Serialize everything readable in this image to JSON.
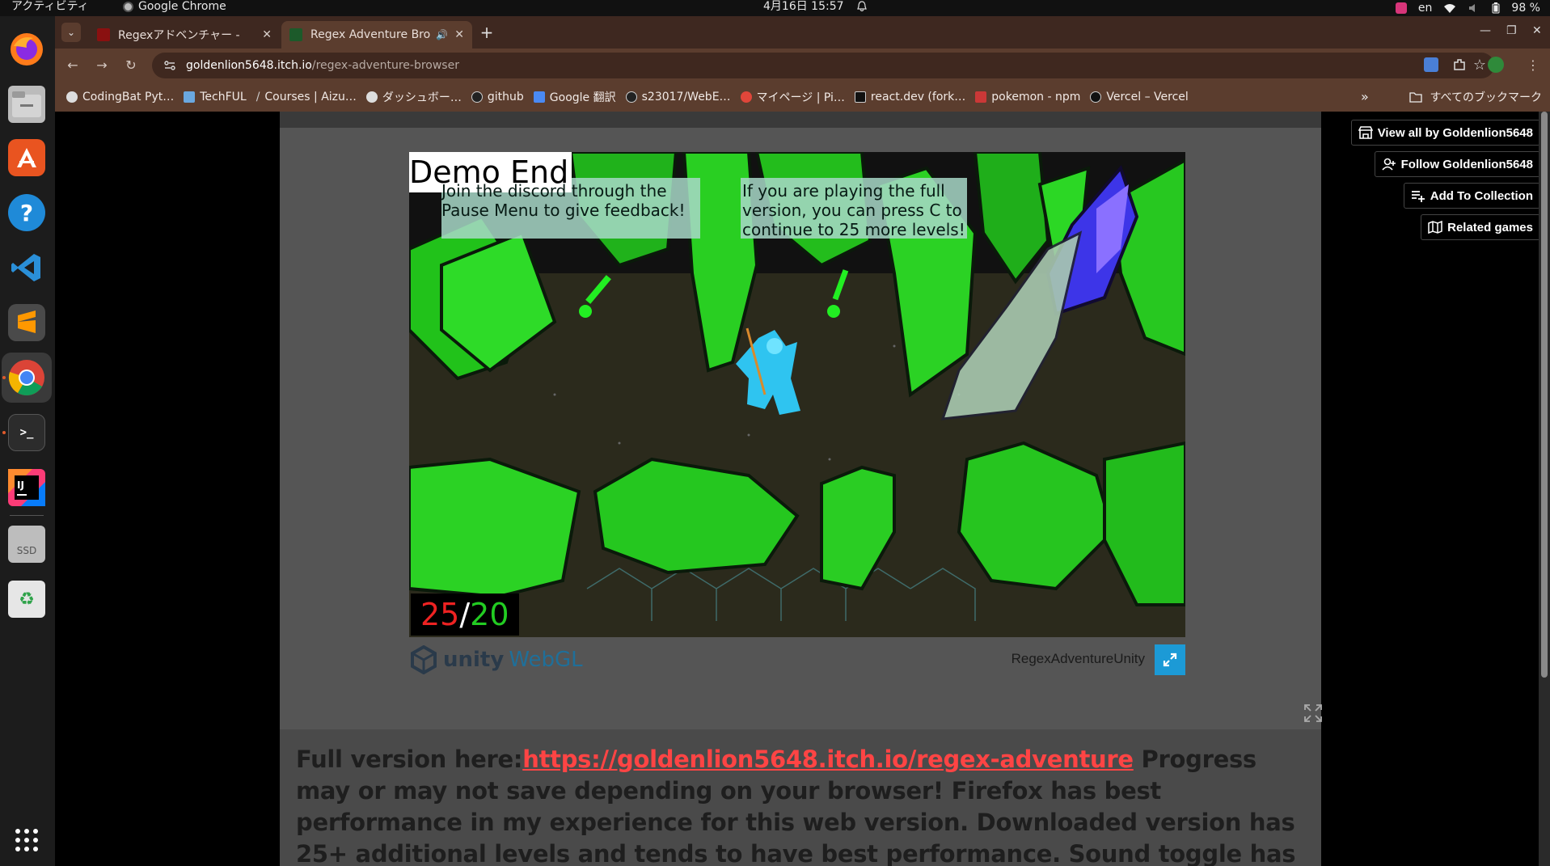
{
  "system_bar": {
    "activities": "アクティビティ",
    "app_name": "Google Chrome",
    "clock": "4月16日  15:57",
    "input_method": "en",
    "battery": "98 %"
  },
  "browser": {
    "tabs": [
      {
        "title": "Regexアドベンチャー - ",
        "active": false
      },
      {
        "title": "Regex Adventure Bro",
        "active": true
      }
    ],
    "url_host": "goldenlion5648.itch.io",
    "url_path": "/regex-adventure-browser",
    "bookmarks": [
      {
        "label": "CodingBat Pyt…",
        "color": "#dddddd"
      },
      {
        "label": "TechFUL",
        "color": "#6aa8e0"
      },
      {
        "label": "Courses | Aizu…",
        "color": "#cccccc"
      },
      {
        "label": "ダッシュボー…",
        "color": "#dddddd"
      },
      {
        "label": "github",
        "color": "#222222"
      },
      {
        "label": "Google 翻訳",
        "color": "#4a8af4"
      },
      {
        "label": "s23017/WebE…",
        "color": "#222222"
      },
      {
        "label": "マイページ | Pi…",
        "color": "#e0463a"
      },
      {
        "label": "react.dev (fork…",
        "color": "#111111"
      },
      {
        "label": "pokemon - npm",
        "color": "#cb3837"
      },
      {
        "label": "Vercel – Vercel",
        "color": "#111111"
      }
    ],
    "all_bookmarks": "すべてのブックマーク"
  },
  "side_buttons": {
    "view_all": "View all by Goldenlion5648",
    "follow": "Follow Goldenlion5648",
    "add_collection": "Add To Collection",
    "related": "Related games"
  },
  "game": {
    "demo_end": "Demo End",
    "hint_left": "Join the discord through the Pause Menu to give feedback!",
    "hint_right": "If you are playing the full version, you can press C to continue to 25 more levels!",
    "counter_current": "25",
    "counter_sep": "/",
    "counter_total": "20",
    "unity_text": "unity",
    "webgl_text": "WebGL",
    "title": "RegexAdventureUnity"
  },
  "description": {
    "prefix": "Full version here:",
    "link": "https://goldenlion5648.itch.io/regex-adventure",
    "rest": " Progress may or may not save depending on your browser! Firefox has best performance in my experience for this web version. Downloaded version has 25+ additional levels and tends to have best performance. Sound toggle has some issues in browser version (go to the tab)."
  }
}
